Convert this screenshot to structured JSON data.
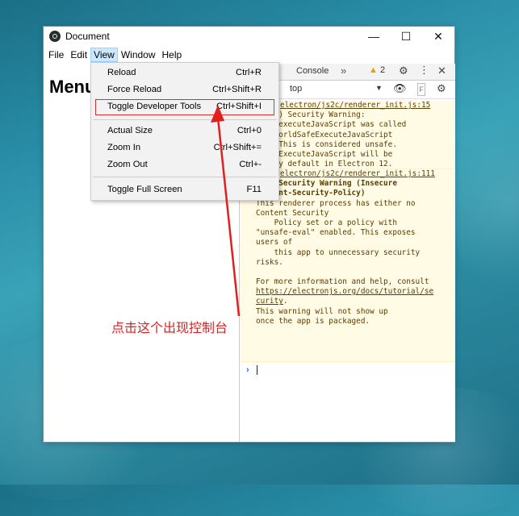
{
  "window": {
    "title": "Document",
    "controls": {
      "minimize": "—",
      "maximize": "☐",
      "close": "✕"
    }
  },
  "menubar": {
    "items": [
      "File",
      "Edit",
      "View",
      "Window",
      "Help"
    ],
    "active": "View"
  },
  "page": {
    "heading": "Menu"
  },
  "view_menu": {
    "items": [
      {
        "label": "Reload",
        "accel": "Ctrl+R"
      },
      {
        "label": "Force Reload",
        "accel": "Ctrl+Shift+R"
      },
      {
        "label": "Toggle Developer Tools",
        "accel": "Ctrl+Shift+I"
      },
      {
        "label": "Actual Size",
        "accel": "Ctrl+0"
      },
      {
        "label": "Zoom In",
        "accel": "Ctrl+Shift+="
      },
      {
        "label": "Zoom Out",
        "accel": "Ctrl+-"
      },
      {
        "label": "Toggle Full Screen",
        "accel": "F11"
      }
    ]
  },
  "devtools": {
    "tab_console": "Console",
    "more": "»",
    "warning_count": "2",
    "context": "top",
    "filter_icon": "F",
    "messages": [
      {
        "source": "electron/js2c/renderer_init.js:15",
        "lines": [
          "ctron) Security Warning:",
          "rame.executeJavaScript was called",
          "out worldSafeExecuteJavaScript",
          "led. This is considered unsafe.",
          "dSafeExecuteJavaScript will be",
          "led by default in Electron 12."
        ]
      },
      {
        "source": "electron/js2c/renderer_init.js:111",
        "title_lines": [
          "tron Security Warning (Insecure",
          "Content-Security-Policy)"
        ],
        "lines": [
          "This renderer process has either no",
          "Content Security",
          "    Policy set or a policy with",
          "\"unsafe-eval\" enabled. This exposes",
          "users of",
          "    this app to unnecessary security",
          "risks.",
          "",
          "For more information and help, consult"
        ],
        "link_lines": [
          "https://electronjs.org/docs/tutorial/se",
          "curity"
        ],
        "tail_lines": [
          "This warning will not show up",
          "once the app is packaged."
        ]
      }
    ],
    "prompt": "›"
  },
  "annotation": {
    "text": "点击这个出现控制台",
    "color": "#e02020"
  },
  "colors": {
    "highlight_border": "#d9302f",
    "menu_active_bg": "#cce8ff",
    "warning_bg": "#fffbe5"
  }
}
